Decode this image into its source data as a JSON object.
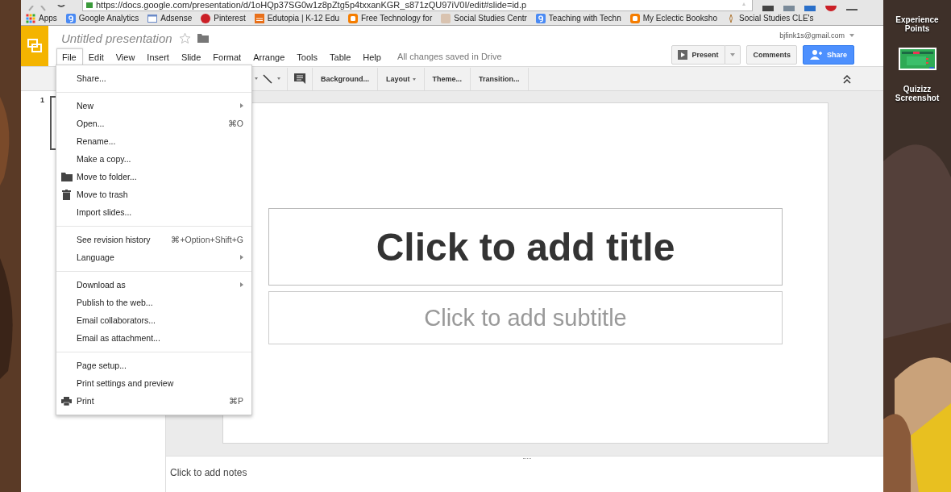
{
  "browser": {
    "url": "https://docs.google.com/presentation/d/1oHQp37SG0w1z8pZtg5p4txxanKGR_s871zQU97iV0I/edit#slide=id.p",
    "bookmarks": [
      {
        "label": "Apps",
        "kind": "apps"
      },
      {
        "label": "Google Analytics",
        "kind": "g"
      },
      {
        "label": "Adsense",
        "kind": "page"
      },
      {
        "label": "Pinterest",
        "kind": "pin"
      },
      {
        "label": "Edutopia | K-12 Edu",
        "kind": "edu"
      },
      {
        "label": "Free Technology for",
        "kind": "blog"
      },
      {
        "label": "Social Studies Centr"
      },
      {
        "label": "Teaching with Techn",
        "kind": "g"
      },
      {
        "label": "My Eclectic Booksho",
        "kind": "blog"
      },
      {
        "label": "Social Studies CLE's",
        "kind": "flame"
      }
    ]
  },
  "document": {
    "title": "Untitled presentation",
    "starred": false,
    "save_status": "All changes saved in Drive",
    "account": "bjfink1s@gmail.com"
  },
  "menubar": [
    {
      "label": "File",
      "selected": true
    },
    {
      "label": "Edit",
      "selected": false
    },
    {
      "label": "View",
      "selected": false
    },
    {
      "label": "Insert",
      "selected": false
    },
    {
      "label": "Slide",
      "selected": false
    },
    {
      "label": "Format",
      "selected": false
    },
    {
      "label": "Arrange",
      "selected": false
    },
    {
      "label": "Tools",
      "selected": false
    },
    {
      "label": "Table",
      "selected": false
    },
    {
      "label": "Help",
      "selected": false
    }
  ],
  "header_buttons": {
    "present": "Present",
    "comments": "Comments",
    "share": "Share"
  },
  "toolbar": [
    {
      "label": "Background...",
      "dropdown": false
    },
    {
      "label": "Layout",
      "dropdown": true
    },
    {
      "label": "Theme...",
      "dropdown": false
    },
    {
      "label": "Transition...",
      "dropdown": false
    }
  ],
  "file_menu": [
    {
      "items": [
        {
          "label": "Share...",
          "submenu": false
        }
      ]
    },
    {
      "items": [
        {
          "label": "New",
          "submenu": true
        },
        {
          "label": "Open...",
          "shortcut": "⌘O",
          "submenu": false
        },
        {
          "label": "Rename...",
          "submenu": false
        },
        {
          "label": "Make a copy...",
          "submenu": false
        },
        {
          "label": "Move to folder...",
          "submenu": false
        },
        {
          "label": "Move to trash",
          "submenu": false
        },
        {
          "label": "Import slides...",
          "submenu": false
        }
      ]
    },
    {
      "items": [
        {
          "label": "See revision history",
          "shortcut": "⌘+Option+Shift+G",
          "submenu": false
        },
        {
          "label": "Language",
          "submenu": true
        }
      ]
    },
    {
      "items": [
        {
          "label": "Download as",
          "submenu": true
        },
        {
          "label": "Publish to the web...",
          "submenu": false
        },
        {
          "label": "Email collaborators...",
          "submenu": false
        },
        {
          "label": "Email as attachment...",
          "submenu": false
        }
      ]
    },
    {
      "items": [
        {
          "label": "Page setup...",
          "submenu": false
        },
        {
          "label": "Print settings and preview",
          "submenu": false
        },
        {
          "label": "Print",
          "shortcut": "⌘P",
          "submenu": false
        }
      ]
    }
  ],
  "filmstrip": {
    "slide_number": "1"
  },
  "slide": {
    "title_placeholder": "Click to add title",
    "subtitle_placeholder": "Click to add subtitle"
  },
  "notes": {
    "placeholder": "Click to add notes"
  },
  "desktop": [
    {
      "label": "Experience Points",
      "kind": "text"
    },
    {
      "label": "Quizizz Screenshot",
      "kind": "picture"
    }
  ]
}
